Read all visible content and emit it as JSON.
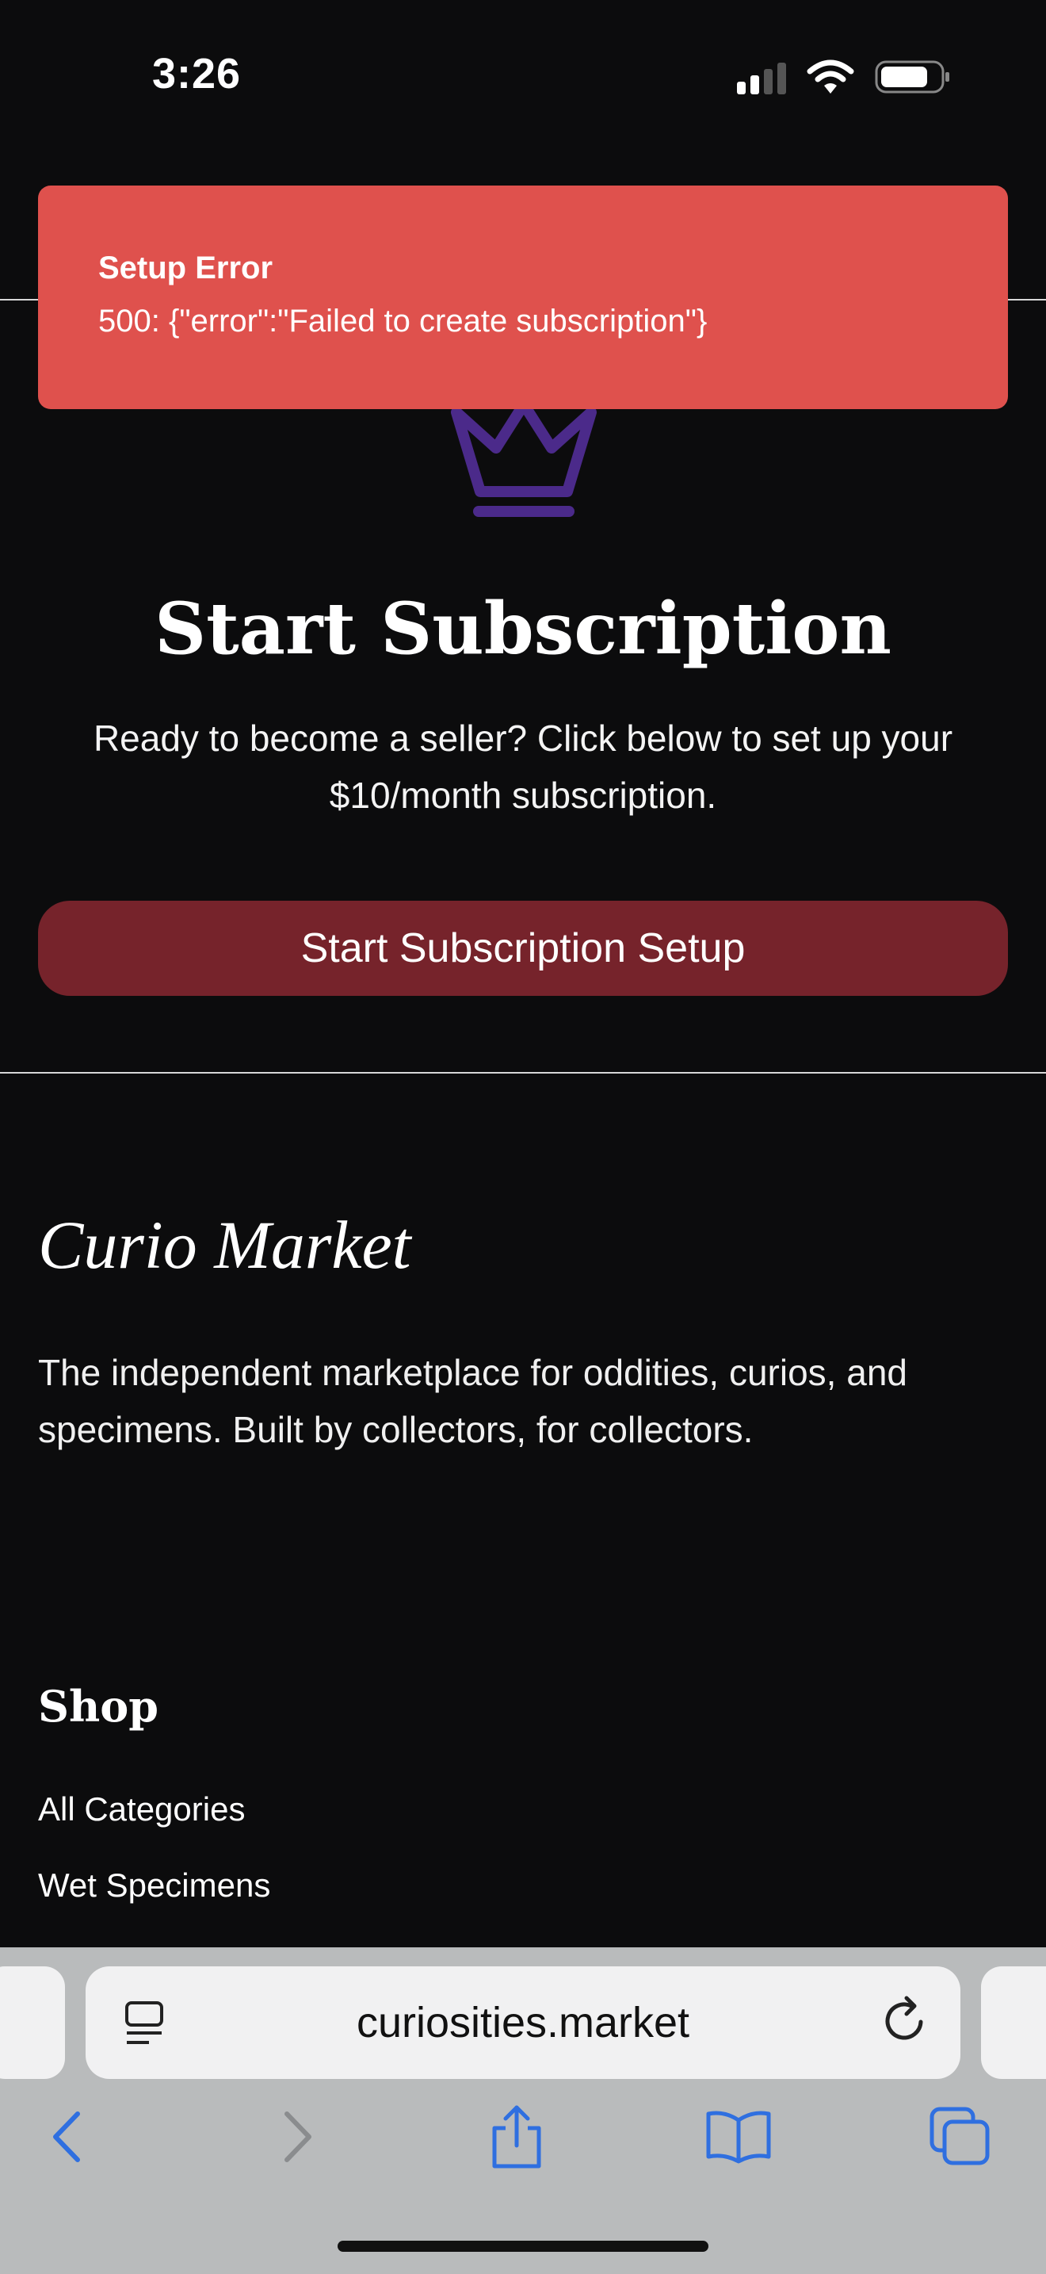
{
  "status_bar": {
    "time": "3:26"
  },
  "toast": {
    "title": "Setup Error",
    "message": "500: {\"error\":\"Failed to create subscription\"}",
    "color": "#df514d"
  },
  "main": {
    "icon": "crown-icon",
    "heading": "Start Subscription",
    "description": "Ready to become a seller? Click below to set up your $10/month subscription.",
    "cta_label": "Start Subscription Setup",
    "cta_color": "#76232b"
  },
  "footer": {
    "logo_text": "Curio Market",
    "tagline": "The independent marketplace for oddities, curios, and specimens. Built by collectors, for collectors.",
    "shop_heading": "Shop",
    "shop_links": [
      "All Categories",
      "Wet Specimens"
    ]
  },
  "browser": {
    "url": "curiosities.market",
    "icons": [
      "reader-icon",
      "reload-icon",
      "back-icon",
      "forward-icon",
      "share-icon",
      "bookmarks-icon",
      "tabs-icon"
    ]
  }
}
